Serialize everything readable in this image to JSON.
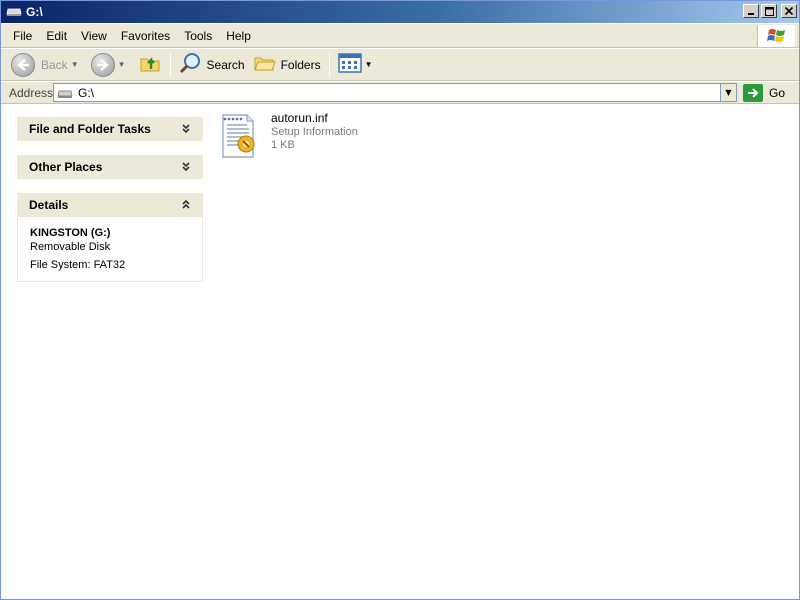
{
  "window": {
    "title": "G:\\"
  },
  "menu": [
    {
      "label": "File"
    },
    {
      "label": "Edit"
    },
    {
      "label": "View"
    },
    {
      "label": "Favorites"
    },
    {
      "label": "Tools"
    },
    {
      "label": "Help"
    }
  ],
  "toolbar": {
    "back_label": "Back",
    "search_label": "Search",
    "folders_label": "Folders"
  },
  "address": {
    "label": "Address",
    "value": "G:\\",
    "go_label": "Go"
  },
  "panels": {
    "file_folder_tasks": "File and Folder Tasks",
    "other_places": "Other Places",
    "details": {
      "title": "Details",
      "drive_name": "KINGSTON (G:)",
      "drive_type": "Removable Disk",
      "file_system": "File System: FAT32"
    }
  },
  "files": [
    {
      "name": "autorun.inf",
      "type": "Setup Information",
      "size": "1 KB"
    }
  ],
  "colors": {
    "titlebar_start": "#0a246a",
    "titlebar_end": "#a6caf0",
    "chrome_bg": "#ece9d8",
    "go_green": "#2c9a3a"
  }
}
